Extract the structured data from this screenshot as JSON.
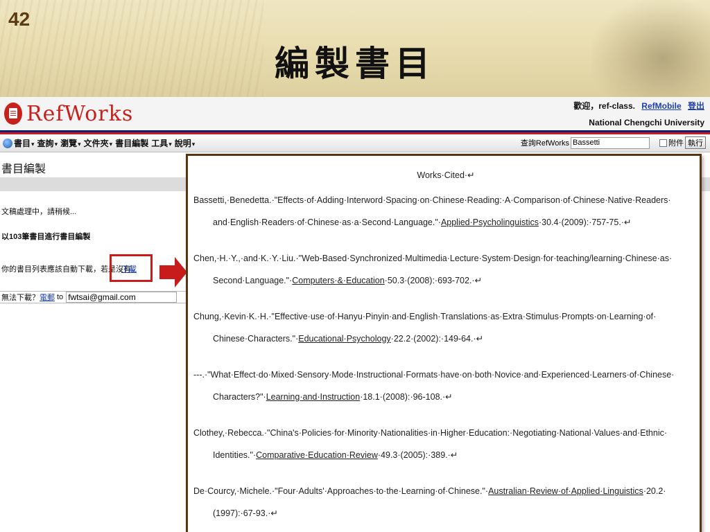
{
  "slide": {
    "number": "42",
    "title": "編製書目"
  },
  "refworks": {
    "logo_text": "RefWorks",
    "welcome": "歡迎，ref-class.",
    "refmobile_link": "RefMobile",
    "logout_link": "登出",
    "university": "National Chengchi University",
    "menu": [
      {
        "label": "書目",
        "caret": true
      },
      {
        "label": "查詢",
        "caret": true
      },
      {
        "label": "瀏覽",
        "caret": true
      },
      {
        "label": "文件夾",
        "caret": true
      },
      {
        "label": "書目編製",
        "caret": false
      },
      {
        "label": "工具",
        "caret": true
      },
      {
        "label": "說明",
        "caret": true
      }
    ],
    "search": {
      "label": "查詢RefWorks",
      "value": "Bassetti",
      "attach_label": "附件",
      "exec_label": "執行"
    },
    "left_panel": {
      "title": "書目編製",
      "status": "文稿處理中，請稍候...",
      "processing": "以103筆書目進行書目編製",
      "download_msg": "你的書目列表應該自動下載，若是沒有，",
      "download_link": "下載",
      "mail_prefix": "無法下載？",
      "mail_link": "電郵",
      "mail_to": "to",
      "mail_value": "fwtsai@gmail.com"
    }
  },
  "document": {
    "heading": "Works·Cited·↵",
    "entries": [
      {
        "line1": "Bassetti,·Benedetta.·\"Effects·of·Adding·Interword·Spacing·on·Chinese·Reading:·A·Comparison·of·Chinese·Native·Readers·",
        "line2_pre": "and·English·Readers·of·Chinese·as·a·Second·Language.\"·",
        "journal": "Applied·Psycholinguistics",
        "line2_post": "·30.4·(2009):·757-75.·↵"
      },
      {
        "line1": "Chen,·H.·Y.,·and·K.·Y.·Liu.·\"Web-Based·Synchronized·Multimedia·Lecture·System·Design·for·teaching/learning·Chinese·as·",
        "line2_pre": "Second·Language.\"·",
        "journal": "Computers·&·Education",
        "line2_post": "·50.3·(2008):·693-702.·↵"
      },
      {
        "line1": "Chung,·Kevin·K.·H.·\"Effective·use·of·Hanyu·Pinyin·and·English·Translations·as·Extra·Stimulus·Prompts·on·Learning·of·",
        "line2_pre": "Chinese·Characters.\"·",
        "journal": "Educational·Psychology",
        "line2_post": "·22.2·(2002):·149-64.·↵"
      },
      {
        "line1": "---.·\"What·Effect·do·Mixed·Sensory·Mode·Instructional·Formats·have·on·both·Novice·and·Experienced·Learners·of·Chinese·",
        "line2_pre": "Characters?\"·",
        "journal": "Learning·and·Instruction",
        "line2_post": "·18.1·(2008):·96-108.·↵"
      },
      {
        "line1": "Clothey,·Rebecca.·\"China's·Policies·for·Minority·Nationalities·in·Higher·Education:·Negotiating·National·Values·and·Ethnic·",
        "line2_pre": "Identities.\"·",
        "journal": "Comparative·Education·Review",
        "line2_post": "·49.3·(2005):·389.·↵"
      },
      {
        "line1_pre": "De·Courcy,·Michele.·\"Four·Adults'·Approaches·to·the·Learning·of·Chinese.\"·",
        "journal": "Australian·Review·of·Applied·Linguistics",
        "line1_post": "·20.2·",
        "line2_pre": "(1997):·67-93.·↵"
      }
    ]
  },
  "colors": {
    "brand_red": "#c8201b",
    "nav_blue": "#0c1f7a",
    "link_blue": "#1b3fb0",
    "doc_border": "#5a3410"
  }
}
